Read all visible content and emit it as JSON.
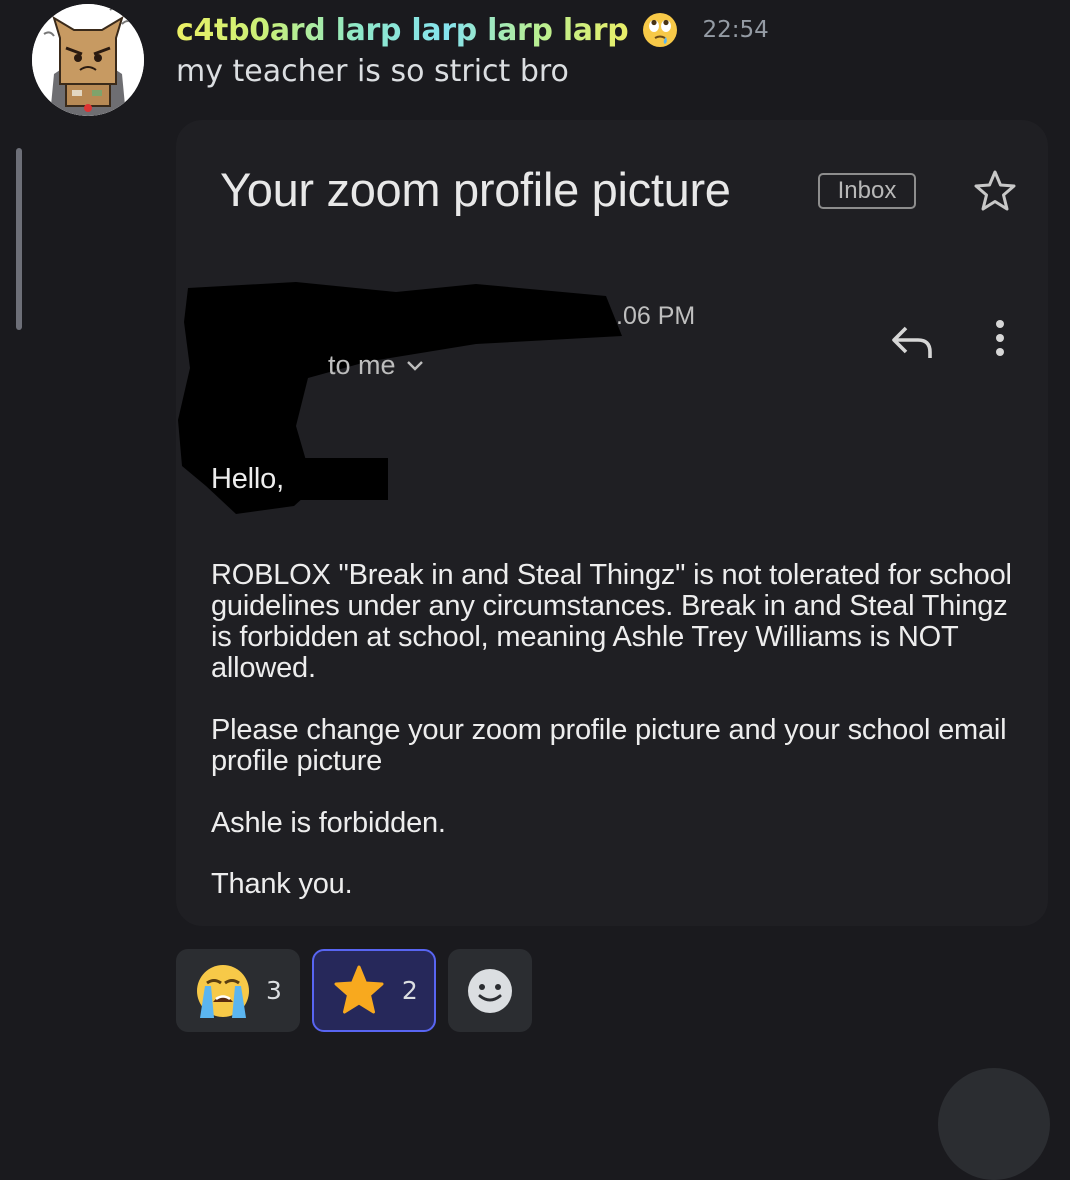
{
  "message": {
    "username": "c4tb0ard larp larp larp larp",
    "timestamp": "22:54",
    "text": "my teacher is so strict bro",
    "role_icon": "face-with-rolling-eyes"
  },
  "email": {
    "subject": "Your zoom profile picture",
    "label_chip": "Inbox",
    "time": ".06 PM",
    "recipient": "to me",
    "greeting": "Hello,",
    "paragraph1": "ROBLOX \"Break in and Steal Thingz\" is not tolerated for school guidelines under any circumstances. Break in and Steal Thingz is forbidden at school, meaning Ashle Trey Williams is NOT allowed.",
    "paragraph2": "Please change your zoom profile picture and your school email profile picture",
    "paragraph3": "Ashle is forbidden.",
    "paragraph4": "Thank you."
  },
  "reactions": [
    {
      "emoji": "loudly-crying-face",
      "count": "3",
      "active": false
    },
    {
      "emoji": "star",
      "count": "2",
      "active": true
    }
  ],
  "colors": {
    "background": "#1a1a1e",
    "attachment_bg": "#1f1f23",
    "active_reaction_border": "#5865f2",
    "timestamp": "#949ba4"
  }
}
